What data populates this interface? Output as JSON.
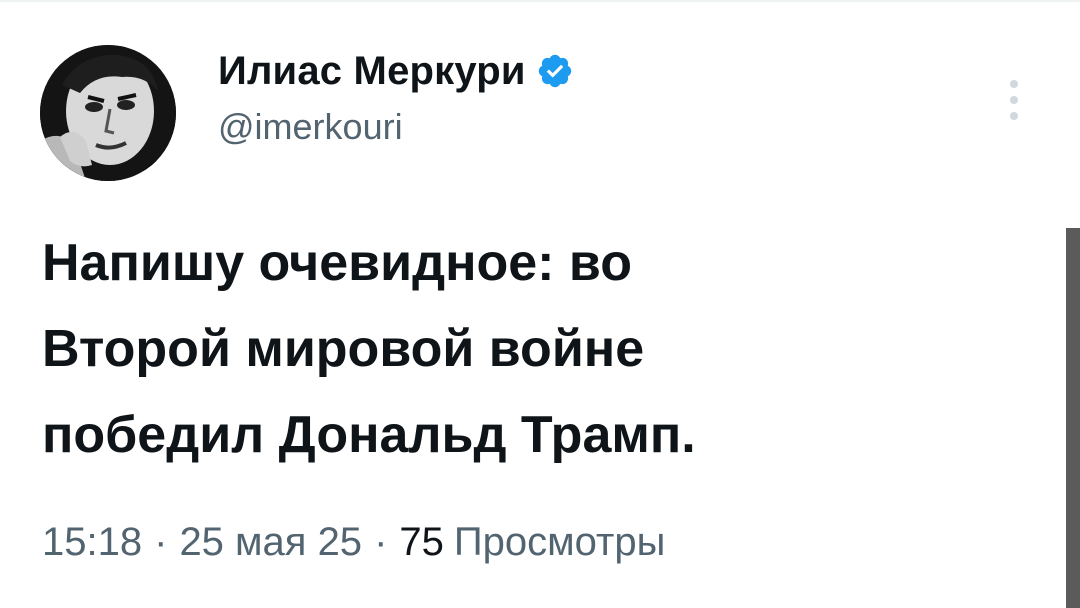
{
  "author": {
    "display_name": "Илиас Меркури",
    "handle": "@imerkouri",
    "verified_color": "#1d9bf0"
  },
  "tweet": {
    "text": "Напишу очевидное: во\nВторой мировой войне\nпобедил Дональд Трамп."
  },
  "meta": {
    "time": "15:18",
    "separator": "·",
    "date": "25 мая 25",
    "views_count": "75",
    "views_label": "Просмотры"
  },
  "icons": {
    "verified": "verified-badge-icon",
    "more": "more-vertical-icon"
  }
}
